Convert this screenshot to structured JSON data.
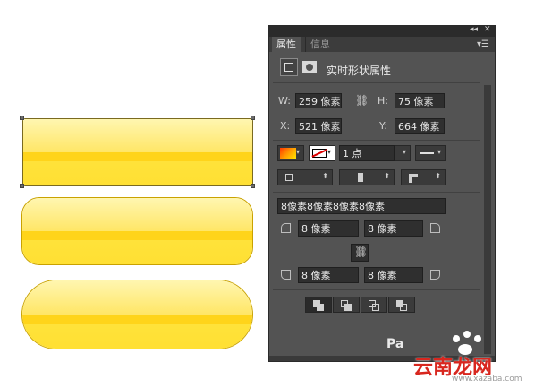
{
  "panel": {
    "tabs": [
      {
        "label": "属性"
      },
      {
        "label": "信息"
      }
    ],
    "title": "实时形状属性",
    "w_label": "W:",
    "w_value": "259 像素",
    "h_label": "H:",
    "h_value": "75 像素",
    "x_label": "X:",
    "x_value": "521 像素",
    "y_label": "Y:",
    "y_value": "664 像素",
    "stroke_width": "1 点",
    "corner_radius_all": "8像素8像素8像素8像素",
    "corner_tl": "8 像素",
    "corner_tr": "8 像素",
    "corner_bl": "8 像素",
    "corner_br": "8 像素",
    "colors": {
      "fill": "#ff9a00",
      "button": "#ffd41a",
      "panel_bg": "#535353"
    }
  },
  "watermark": {
    "logo": "Pa",
    "brand": "云南龙网",
    "url": "www.xazaba.com"
  }
}
